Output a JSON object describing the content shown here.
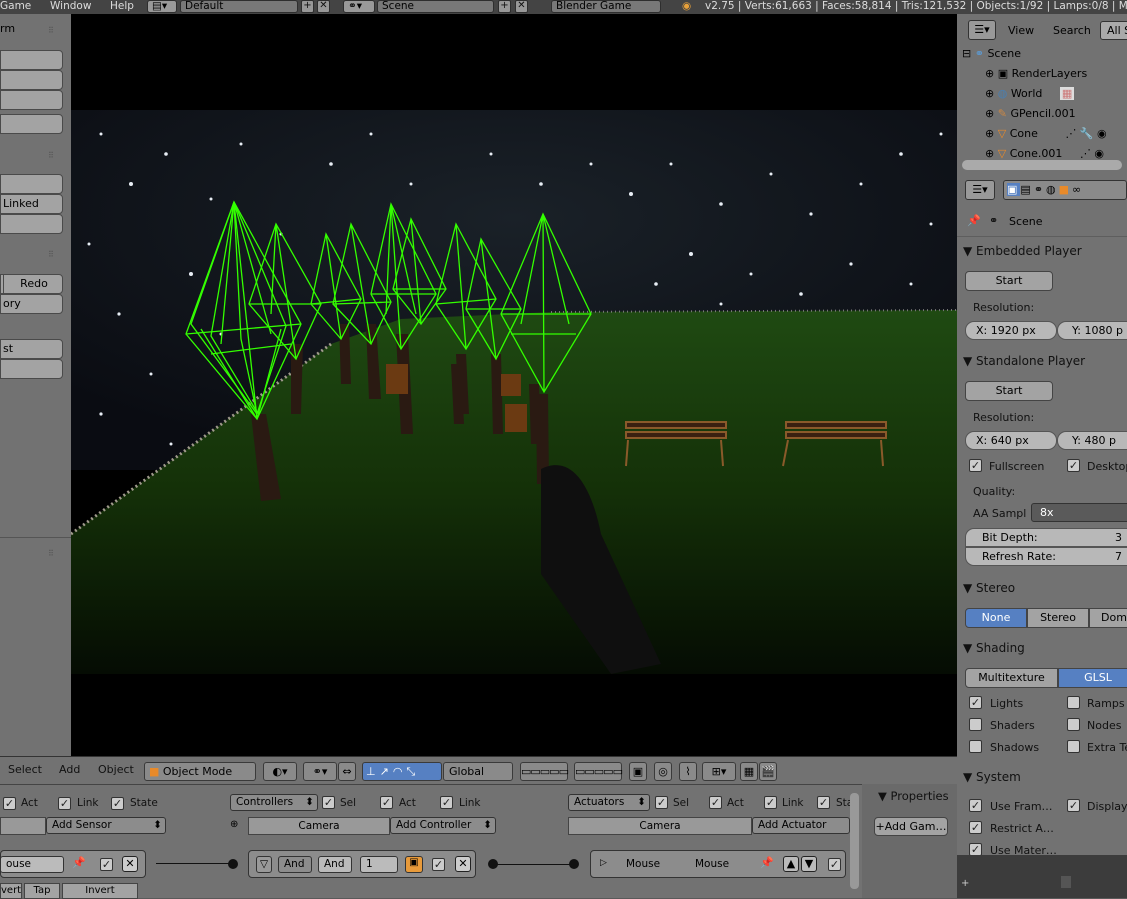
{
  "topbar": {
    "menus": [
      "Game",
      "Window",
      "Help"
    ],
    "screen_layout": "Default",
    "scene_name": "Scene",
    "engine": "Blender Game",
    "stats": "v2.75 | Verts:61,663 | Faces:58,814 | Tris:121,532 | Objects:1/92 | Lamps:0/8 | Mem"
  },
  "left_panel": {
    "label_top": "rm",
    "linked_label": "Linked",
    "redo_label": "Redo",
    "history_label": "ory",
    "last_label": "st"
  },
  "outliner": {
    "menu_view": "View",
    "menu_search": "Search",
    "filter": "All S",
    "items": [
      {
        "label": "Scene",
        "icon": "scene-icon"
      },
      {
        "label": "RenderLayers",
        "icon": "renderlayers-icon"
      },
      {
        "label": "World",
        "icon": "world-icon"
      },
      {
        "label": "GPencil.001",
        "icon": "pencil-icon"
      },
      {
        "label": "Cone",
        "icon": "cone-icon"
      },
      {
        "label": "Cone.001",
        "icon": "cone-icon"
      }
    ]
  },
  "properties": {
    "context": "Scene",
    "embedded": {
      "title": "Embedded Player",
      "start": "Start",
      "resolution_label": "Resolution:",
      "x": "X:  1920 px",
      "y": "Y:   1080 p"
    },
    "standalone": {
      "title": "Standalone Player",
      "start": "Start",
      "resolution_label": "Resolution:",
      "x": "X:    640 px",
      "y": "Y:    480 p",
      "fullscreen": "Fullscreen",
      "desktop": "Desktop",
      "quality_label": "Quality:",
      "aa_label": "AA Sampl",
      "aa_value": "8x",
      "bit_depth": "Bit Depth:",
      "bit_depth_val": "3",
      "refresh_rate": "Refresh Rate:",
      "refresh_val": "7"
    },
    "stereo": {
      "title": "Stereo",
      "options": [
        "None",
        "Stereo",
        "Dom"
      ]
    },
    "shading": {
      "title": "Shading",
      "options": [
        "Multitexture",
        "GLSL"
      ],
      "checks": [
        {
          "label": "Lights",
          "checked": true
        },
        {
          "label": "Ramps",
          "checked": false
        },
        {
          "label": "Shaders",
          "checked": false
        },
        {
          "label": "Nodes",
          "checked": false
        },
        {
          "label": "Shadows",
          "checked": false
        },
        {
          "label": "Extra Te",
          "checked": false
        }
      ]
    },
    "system": {
      "title": "System",
      "checks": [
        {
          "label": "Use Fram…",
          "checked": true
        },
        {
          "label": "Display",
          "checked": true
        },
        {
          "label": "Restrict A…",
          "checked": true
        },
        {
          "label": "Use Mater…",
          "checked": true
        }
      ]
    }
  },
  "viewport_header": {
    "menus": [
      "Select",
      "Add",
      "Object"
    ],
    "mode": "Object Mode",
    "orientation": "Global"
  },
  "logic": {
    "sensors": {
      "checks": [
        "Act",
        "Link",
        "State"
      ],
      "add_label": "Add Sensor",
      "name": "ouse"
    },
    "controllers": {
      "dropdown": "Controllers",
      "checks": [
        "Sel",
        "Act",
        "Link"
      ],
      "object": "Camera",
      "add_label": "Add Controller",
      "type": "And",
      "name": "And",
      "state": "1"
    },
    "actuators": {
      "dropdown": "Actuators",
      "checks": [
        "Sel",
        "Act",
        "Link",
        "Sta"
      ],
      "object": "Camera",
      "add_label": "Add Actuator",
      "type": "Mouse",
      "name": "Mouse"
    },
    "properties_title": "Properties",
    "add_game_label": "Add Gam…",
    "bottom_labels": [
      "vert",
      "Tap",
      "Invert"
    ]
  },
  "colors": {
    "cone_green": "#33ff00",
    "accent_blue": "#5680c2",
    "panel_bg": "#727272"
  }
}
